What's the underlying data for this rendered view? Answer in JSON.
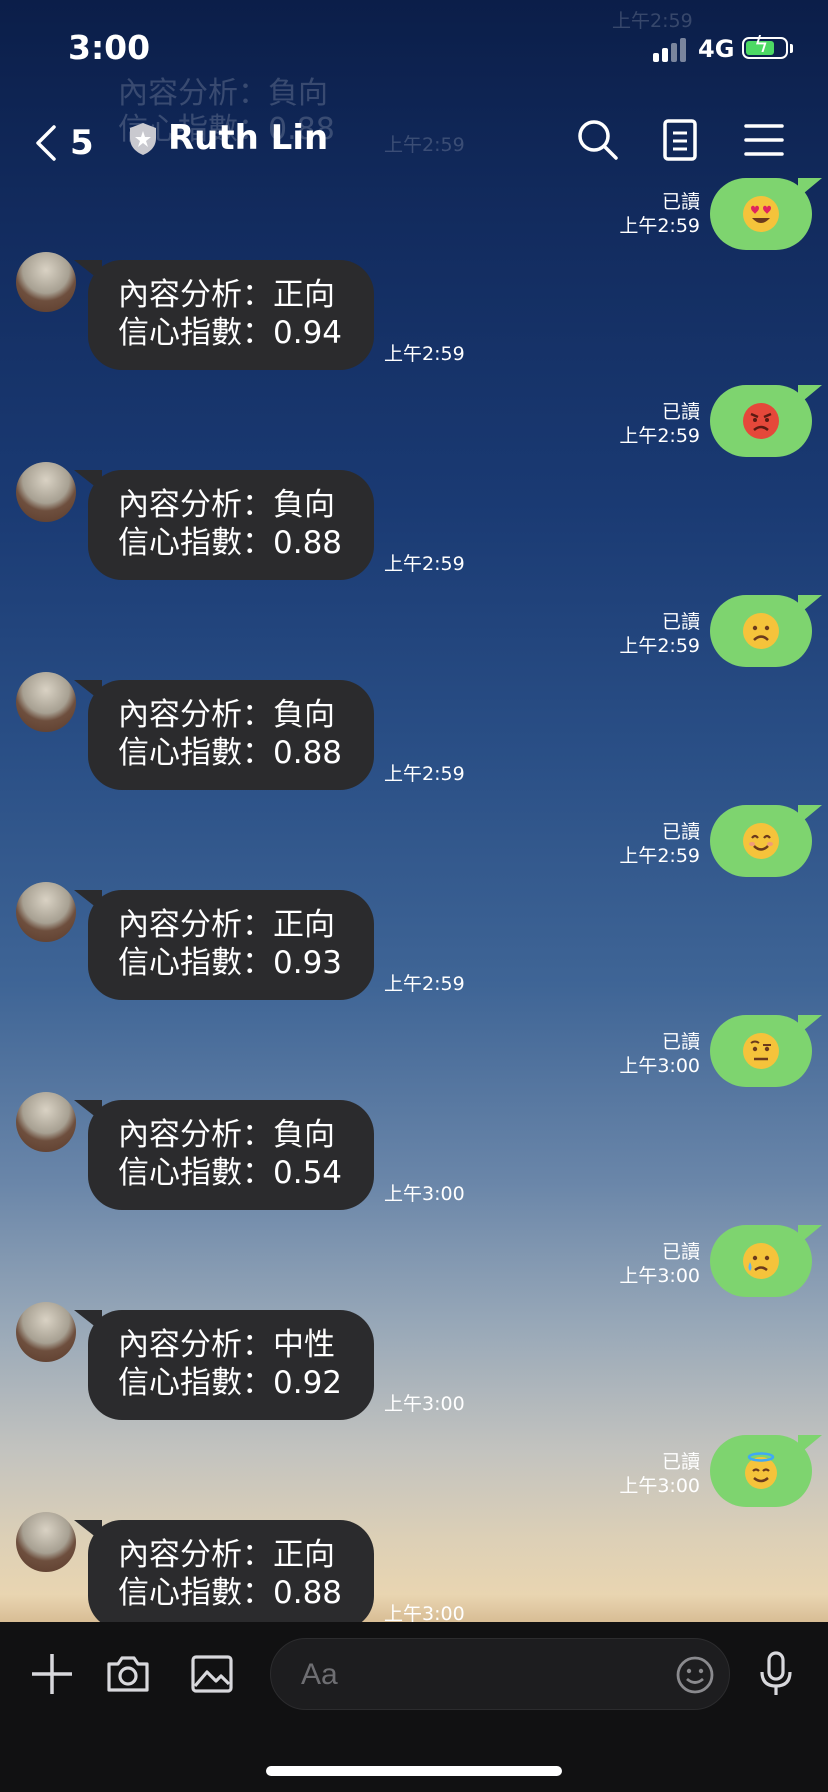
{
  "status_bar": {
    "time": "3:00",
    "network": "4G"
  },
  "ghost": {
    "line1": "內容分析：負向",
    "line2": "信心指數：0.88",
    "time_top": "上午2:59",
    "time_mid": "上午2:59"
  },
  "header": {
    "back_count": "5",
    "contact_name": "Ruth Lin",
    "icons": [
      "search-icon",
      "notes-icon",
      "menu-icon"
    ]
  },
  "messages": [
    {
      "type": "out",
      "emoji": "heart-eyes",
      "read": "已讀",
      "time": "上午2:59"
    },
    {
      "type": "in",
      "line1": "內容分析：正向",
      "line2": "信心指數：0.94",
      "time": "上午2:59"
    },
    {
      "type": "out",
      "emoji": "angry",
      "read": "已讀",
      "time": "上午2:59"
    },
    {
      "type": "in",
      "line1": "內容分析：負向",
      "line2": "信心指數：0.88",
      "time": "上午2:59"
    },
    {
      "type": "out",
      "emoji": "frowning",
      "read": "已讀",
      "time": "上午2:59"
    },
    {
      "type": "in",
      "line1": "內容分析：負向",
      "line2": "信心指數：0.88",
      "time": "上午2:59"
    },
    {
      "type": "out",
      "emoji": "smiling",
      "read": "已讀",
      "time": "上午2:59"
    },
    {
      "type": "in",
      "line1": "內容分析：正向",
      "line2": "信心指數：0.93",
      "time": "上午2:59"
    },
    {
      "type": "out",
      "emoji": "raised-eyebrow",
      "read": "已讀",
      "time": "上午3:00"
    },
    {
      "type": "in",
      "line1": "內容分析：負向",
      "line2": "信心指數：0.54",
      "time": "上午3:00"
    },
    {
      "type": "out",
      "emoji": "sad-tear",
      "read": "已讀",
      "time": "上午3:00"
    },
    {
      "type": "in",
      "line1": "內容分析：中性",
      "line2": "信心指數：0.92",
      "time": "上午3:00"
    },
    {
      "type": "out",
      "emoji": "halo",
      "read": "已讀",
      "time": "上午3:00"
    },
    {
      "type": "in",
      "line1": "內容分析：正向",
      "line2": "信心指數：0.88",
      "time": "上午3:00"
    }
  ],
  "input_bar": {
    "placeholder": "Aa"
  },
  "colors": {
    "bubble_out": "#7ed46f",
    "bubble_in": "#2b2b2d",
    "battery": "#4cd964"
  }
}
